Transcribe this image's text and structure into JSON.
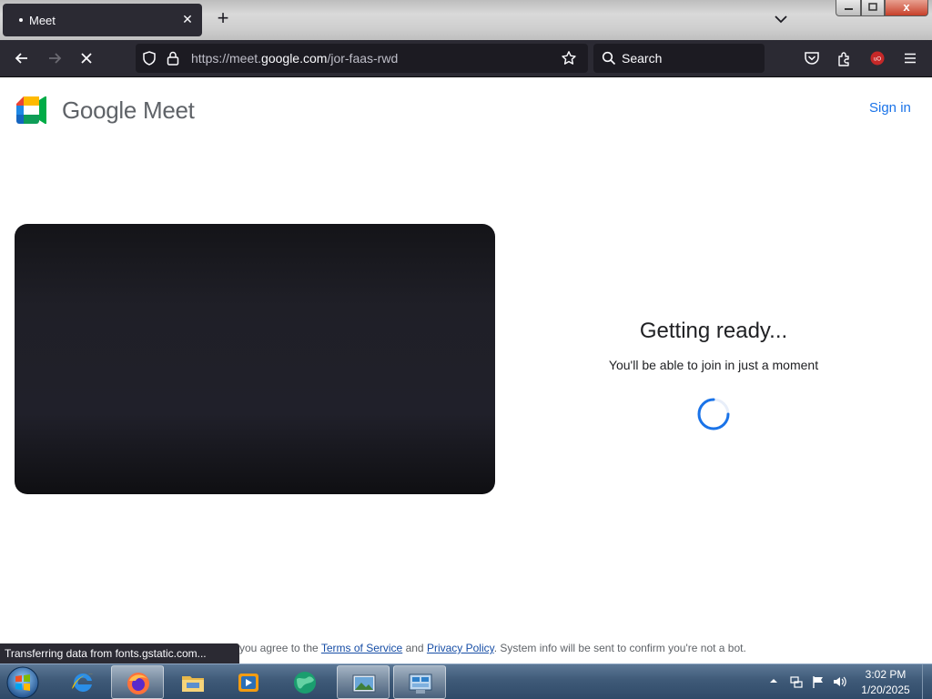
{
  "browser": {
    "tab_title": "Meet",
    "tab_close": "✕",
    "new_tab": "+",
    "window_close": "x",
    "url_prefix": "https://meet.",
    "url_domain": "google.com",
    "url_path": "/jor-faas-rwd",
    "search_placeholder": "Search",
    "status_text": "Transferring data from fonts.gstatic.com..."
  },
  "page": {
    "brand": "Google Meet",
    "sign_in": "Sign in",
    "title": "Getting ready...",
    "subtitle": "You'll be able to join in just a moment",
    "legal_prefix": "you agree to the",
    "terms_link": "Terms of Service",
    "and": "and",
    "privacy_link": "Privacy Policy",
    "legal_suffix": ". System info will be sent to confirm you're not a bot."
  },
  "taskbar": {
    "time": "3:02 PM",
    "date": "1/20/2025",
    "apps": [
      "internet-explorer",
      "firefox",
      "file-explorer",
      "media-player",
      "browser-globe",
      "picture-viewer",
      "control-panel"
    ]
  },
  "colors": {
    "accent_blue": "#1a73e8",
    "browser_chrome": "#2b2a33",
    "firefox_ublock": "#c62828"
  }
}
